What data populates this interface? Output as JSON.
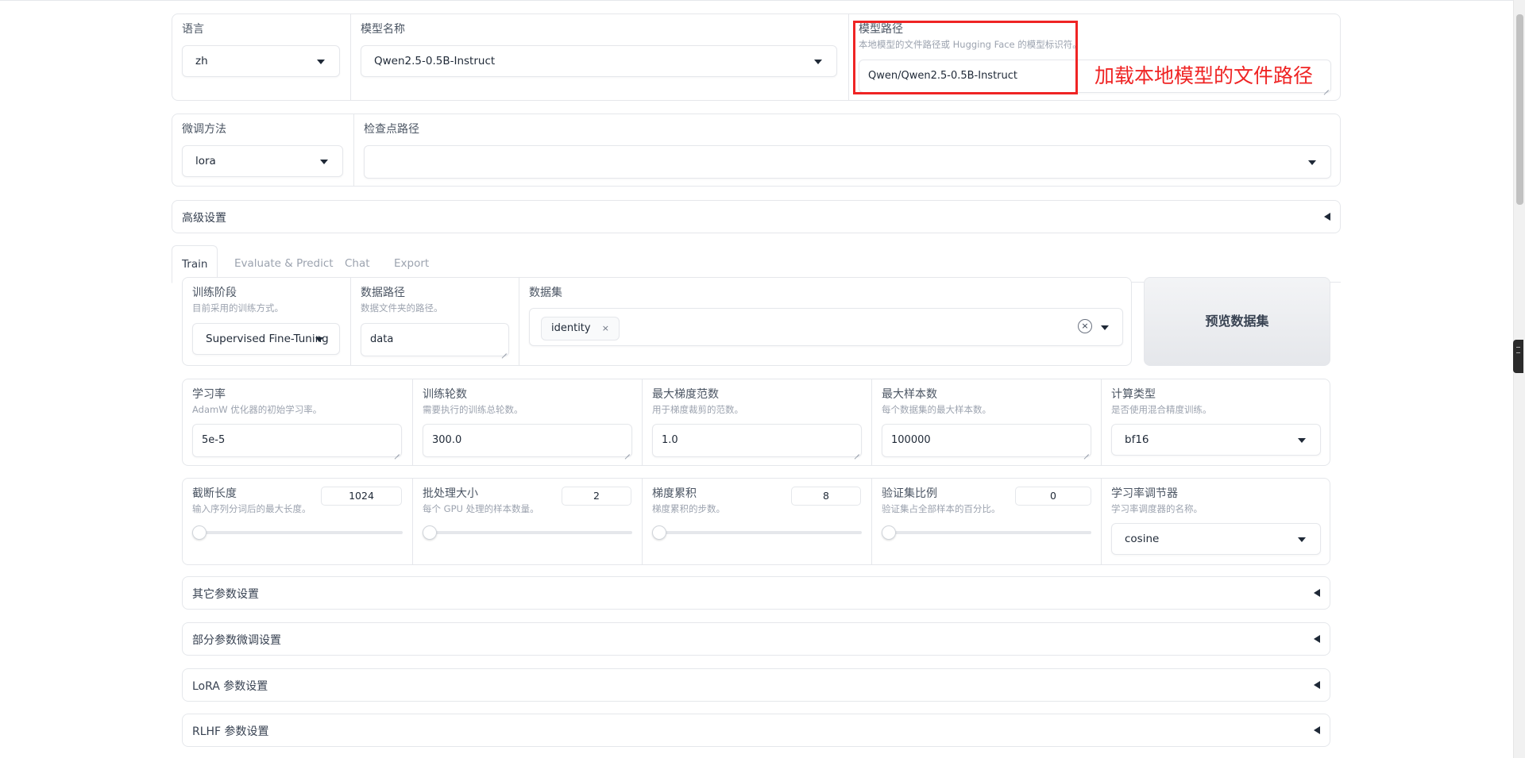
{
  "model_row": {
    "lang": {
      "label": "语言",
      "value": "zh"
    },
    "model_name": {
      "label": "模型名称",
      "value": "Qwen2.5-0.5B-Instruct"
    },
    "model_path": {
      "label": "模型路径",
      "info": "本地模型的文件路径或 Hugging Face 的模型标识符。",
      "value": "Qwen/Qwen2.5-0.5B-Instruct"
    }
  },
  "annotation": {
    "text": "加载本地模型的文件路径",
    "color": "#ef2424"
  },
  "method_row": {
    "finetuning_type": {
      "label": "微调方法",
      "value": "lora"
    },
    "checkpoint": {
      "label": "检查点路径",
      "value": ""
    }
  },
  "advanced": {
    "title": "高级设置"
  },
  "tabs": [
    "Train",
    "Evaluate & Predict",
    "Chat",
    "Export"
  ],
  "train": {
    "stage": {
      "label": "训练阶段",
      "info": "目前采用的训练方式。",
      "value": "Supervised Fine-Tuning"
    },
    "dataset_dir": {
      "label": "数据路径",
      "info": "数据文件夹的路径。",
      "value": "data"
    },
    "dataset": {
      "label": "数据集",
      "chips": [
        "identity"
      ],
      "remove": "×",
      "clear": "×"
    },
    "preview_button": "预览数据集",
    "row2": [
      {
        "label": "学习率",
        "info": "AdamW 优化器的初始学习率。",
        "value": "5e-5"
      },
      {
        "label": "训练轮数",
        "info": "需要执行的训练总轮数。",
        "value": "300.0"
      },
      {
        "label": "最大梯度范数",
        "info": "用于梯度裁剪的范数。",
        "value": "1.0"
      },
      {
        "label": "最大样本数",
        "info": "每个数据集的最大样本数。",
        "value": "100000"
      },
      {
        "label": "计算类型",
        "info": "是否使用混合精度训练。",
        "value": "bf16"
      }
    ],
    "row3": [
      {
        "label": "截断长度",
        "info": "输入序列分词后的最大长度。",
        "value": "1024"
      },
      {
        "label": "批处理大小",
        "info": "每个 GPU 处理的样本数量。",
        "value": "2"
      },
      {
        "label": "梯度累积",
        "info": "梯度累积的步数。",
        "value": "8"
      },
      {
        "label": "验证集比例",
        "info": "验证集占全部样本的百分比。",
        "value": "0"
      },
      {
        "label": "学习率调节器",
        "info": "学习率调度器的名称。",
        "value": "cosine"
      }
    ],
    "accordions": [
      "其它参数设置",
      "部分参数微调设置",
      "LoRA 参数设置",
      "RLHF 参数设置"
    ]
  }
}
